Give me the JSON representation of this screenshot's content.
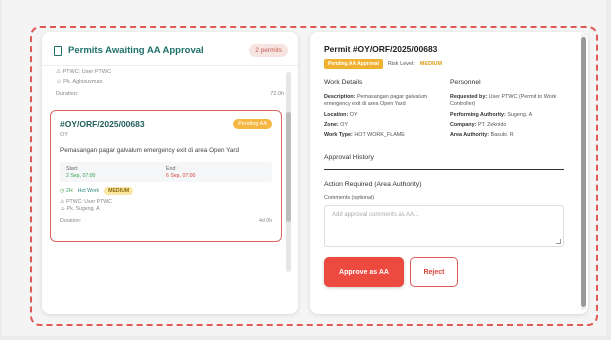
{
  "left_panel": {
    "title": "Permits Awaiting AA Approval",
    "count": "2 permits",
    "prev_item": {
      "requested_by": "PTWC: User PTWC",
      "authority": "Pk. Aghisuvman",
      "duration_label": "Duration:",
      "duration": "72.0h"
    },
    "selected": {
      "id": "#OY/ORF/2025/00683",
      "status": "Pending AA",
      "zone": "OY",
      "description": "Pemasangan pagar galvalum emergency exit di area Open Yard",
      "start_label": "Start:",
      "start": "2 Sep, 07:00",
      "end_label": "End:",
      "end": "6 Sep, 07:00",
      "hours": "◷ 2H",
      "type": "Hot Work",
      "risk": "MEDIUM",
      "requested_by": "PTWC: User PTWC",
      "authority": "Pk. Sugeng. A",
      "duration_label": "Duration:",
      "duration": "4d 0h"
    }
  },
  "detail": {
    "permit_title": "Permit #OY/ORF/2025/00683",
    "status_badge": "Pending AA Approval",
    "risk_label": "Risk Level:",
    "risk_value": "MEDIUM",
    "work_details": {
      "heading": "Work Details",
      "description_label": "Description:",
      "description": "Pemasangan pagar galvalum emergency exit di area Open Yard",
      "location_label": "Location:",
      "location": "OY",
      "zone_label": "Zone:",
      "zone": "OY",
      "work_type_label": "Work Type:",
      "work_type": "HOT WORK_FLAME"
    },
    "personnel": {
      "heading": "Personnel",
      "requested_by_label": "Requested by:",
      "requested_by": "User PTWC (Permit to Work Controller)",
      "performing_label": "Performing Authority:",
      "performing": "Sugeng. A",
      "company_label": "Company:",
      "company": "PT. Zeknido",
      "area_label": "Area Authority:",
      "area": "Basuki. R"
    },
    "approval_history": "Approval History",
    "action_required": "Action Required (Area Authority)",
    "comments_label": "Comments (optional)",
    "comments_placeholder": "Add approval comments as AA...",
    "approve_button": "Approve as AA",
    "reject_button": "Reject"
  },
  "colors": {
    "accent": "#1f6f6a",
    "danger": "#ec4a3f",
    "warning": "#f0b131"
  }
}
